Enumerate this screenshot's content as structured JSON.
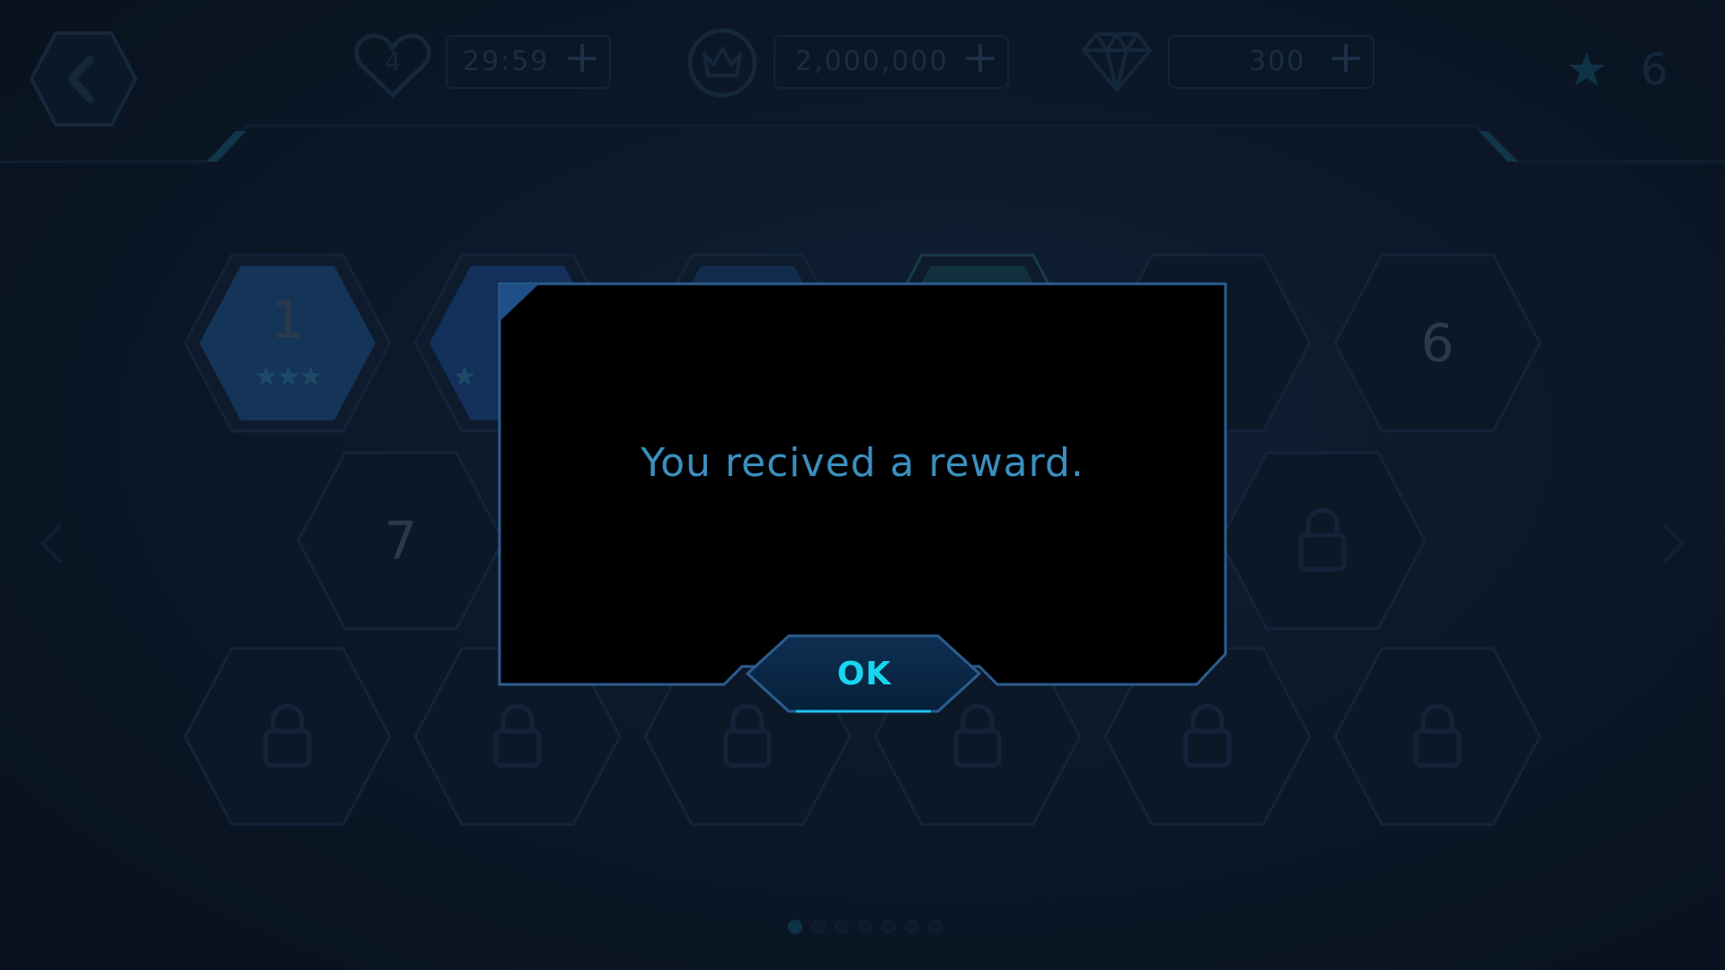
{
  "hud": {
    "back_icon": "back-arrow-icon",
    "lives": {
      "icon": "heart-icon",
      "count": "4",
      "timer": "29:59"
    },
    "coins": {
      "icon": "crown-icon",
      "value": "2,000,000"
    },
    "gems": {
      "icon": "diamond-icon",
      "value": "300"
    },
    "stars": {
      "icon": "star-icon",
      "value": "6"
    }
  },
  "levels": {
    "row1": [
      {
        "label": "1",
        "stars": "★★★"
      },
      {
        "label": "",
        "stars": "★"
      },
      {
        "label": "",
        "stars": ""
      },
      {
        "label": "",
        "stars": ""
      },
      {
        "label": "",
        "stars": ""
      },
      {
        "label": "6",
        "stars": ""
      }
    ],
    "row2": [
      {
        "label": "7"
      }
    ]
  },
  "dialog": {
    "message": "You recived a reward.",
    "ok_label": "OK"
  },
  "colors": {
    "background": "#0a1524",
    "dialog_border": "#2c5d8f",
    "dialog_text": "#3a8fbf",
    "ok_text": "#19d6f0"
  }
}
